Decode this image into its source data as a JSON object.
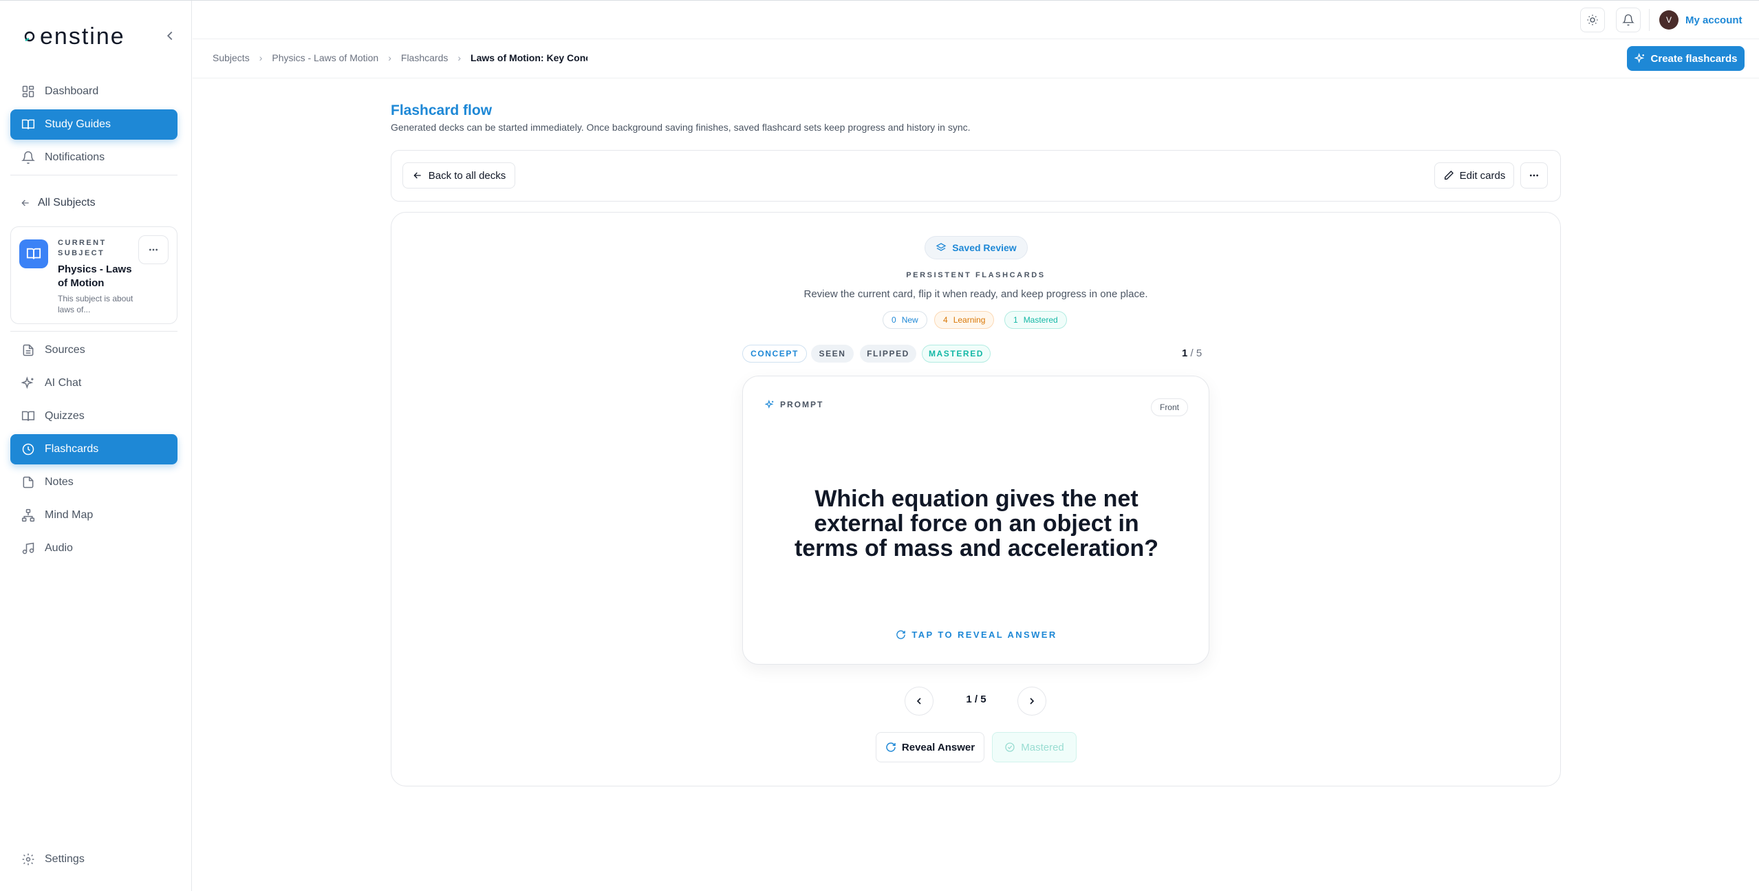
{
  "brand": {
    "name": "enstine"
  },
  "sidebar": {
    "nav_top": [
      {
        "label": "Dashboard",
        "icon": "dashboard-icon"
      },
      {
        "label": "Study Guides",
        "icon": "book-open-icon",
        "active": true
      },
      {
        "label": "Notifications",
        "icon": "bell-icon"
      }
    ],
    "back_label": "All Subjects",
    "current_subject": {
      "caption": "CURRENT SUBJECT",
      "name": "Physics - Laws of Motion",
      "description": "This subject is about laws of..."
    },
    "nav_tools": [
      {
        "label": "Sources",
        "icon": "file-icon"
      },
      {
        "label": "AI Chat",
        "icon": "sparkles-icon"
      },
      {
        "label": "Quizzes",
        "icon": "book-icon"
      },
      {
        "label": "Flashcards",
        "icon": "clock-icon",
        "active": true
      },
      {
        "label": "Notes",
        "icon": "note-icon"
      },
      {
        "label": "Mind Map",
        "icon": "mind-map-icon"
      },
      {
        "label": "Audio",
        "icon": "music-icon"
      }
    ],
    "settings_label": "Settings"
  },
  "topbar": {
    "account_initial": "V",
    "account_label": "My account"
  },
  "breadcrumbs": [
    "Subjects",
    "Physics - Laws of Motion",
    "Flashcards",
    "Laws of Motion: Key Conce"
  ],
  "create_button": "Create flashcards",
  "flow": {
    "title": "Flashcard flow",
    "subtitle": "Generated decks can be started immediately. Once background saving finishes, saved flashcard sets keep progress and history in sync."
  },
  "toolbar": {
    "back_label": "Back to all decks",
    "edit_label": "Edit cards"
  },
  "review": {
    "badge": "Saved Review",
    "heading": "PERSISTENT FLASHCARDS",
    "description": "Review the current card, flip it when ready, and keep progress in one place.",
    "stats": [
      {
        "count": "0",
        "label": "New"
      },
      {
        "count": "4",
        "label": "Learning"
      },
      {
        "count": "1",
        "label": "Mastered"
      }
    ],
    "tags": [
      "CONCEPT",
      "SEEN",
      "FLIPPED",
      "MASTERED"
    ],
    "counter_current": "1",
    "counter_total": "/ 5"
  },
  "card": {
    "label": "PROMPT",
    "side": "Front",
    "question": "Which equation gives the net external force on an object in terms of mass and acceleration?",
    "hint": "TAP TO REVEAL ANSWER"
  },
  "pager": "1 / 5",
  "actions": {
    "reveal": "Reveal Answer",
    "mastered": "Mastered"
  },
  "colors": {
    "accent": "#1e88d6",
    "learning": "#d97706",
    "mastered": "#14b8a6"
  }
}
